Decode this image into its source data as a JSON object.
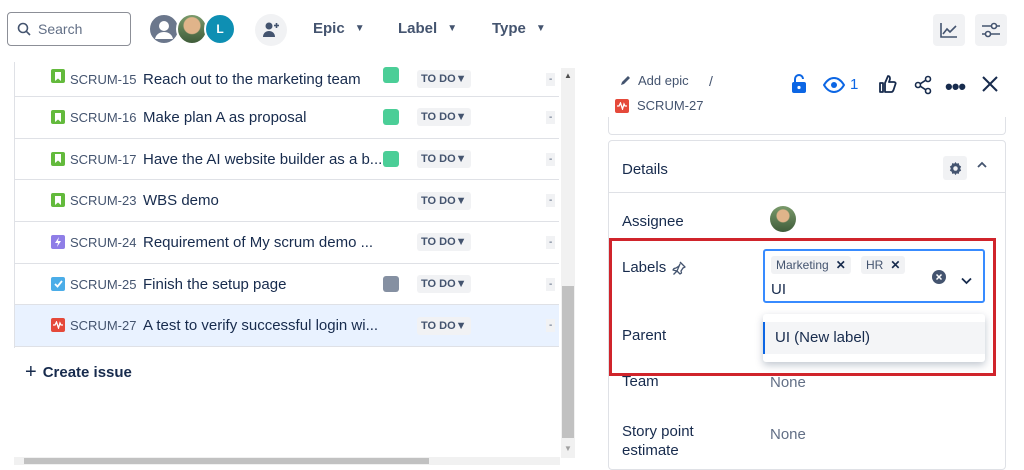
{
  "topbar": {
    "search_placeholder": "Search",
    "avatar_letter": "L",
    "filters": [
      {
        "label": "Epic"
      },
      {
        "label": "Label"
      },
      {
        "label": "Type"
      }
    ]
  },
  "issues": [
    {
      "key": "SCRUM-15",
      "summary": "Reach out to the marketing team",
      "status": "TO DO",
      "type": "story",
      "type_color": "#63ba3c",
      "has_square": true,
      "square_color": "#4bce97"
    },
    {
      "key": "SCRUM-16",
      "summary": "Make plan A as proposal",
      "status": "TO DO",
      "type": "story",
      "type_color": "#63ba3c",
      "has_square": true,
      "square_color": "#4bce97"
    },
    {
      "key": "SCRUM-17",
      "summary": "Have the AI website builder as a b...",
      "status": "TO DO",
      "type": "story",
      "type_color": "#63ba3c",
      "has_square": true,
      "square_color": "#4bce97"
    },
    {
      "key": "SCRUM-23",
      "summary": "WBS demo",
      "status": "TO DO",
      "type": "story",
      "type_color": "#63ba3c",
      "has_square": false,
      "square_color": ""
    },
    {
      "key": "SCRUM-24",
      "summary": "Requirement of My scrum demo ...",
      "status": "TO DO",
      "type": "epic",
      "type_color": "#8f7ee7",
      "has_square": false,
      "square_color": ""
    },
    {
      "key": "SCRUM-25",
      "summary": "Finish the setup page",
      "status": "TO DO",
      "type": "task",
      "type_color": "#4bade8",
      "has_square": true,
      "square_color": "#8590a2"
    },
    {
      "key": "SCRUM-27",
      "summary": "A test to verify successful login wi...",
      "status": "TO DO",
      "type": "bug",
      "type_color": "#e5493a",
      "has_square": false,
      "square_color": ""
    }
  ],
  "create_issue": "Create issue",
  "panel": {
    "add_epic": "Add epic",
    "separator": "/",
    "issue_key": "SCRUM-27",
    "watchers": "1",
    "details_title": "Details",
    "assignee_label": "Assignee",
    "labels_label": "Labels",
    "labels": [
      "Marketing",
      "HR"
    ],
    "labels_input_value": "UI",
    "suggestion": "UI (New label)",
    "parent_label": "Parent",
    "team_label": "Team",
    "team_value": "None",
    "story_point_label": "Story point",
    "story_point_label2": "estimate",
    "story_point_value": "None"
  },
  "colors": {
    "accent": "#0c66e4",
    "highlight_border": "#d0242b",
    "selected_row": "#e9f2ff"
  }
}
